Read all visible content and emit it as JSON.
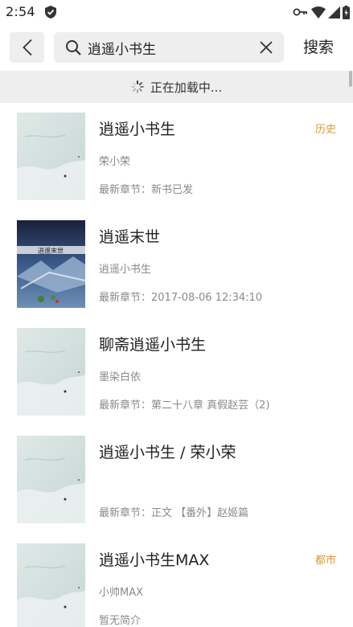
{
  "status_bar": {
    "time": "2:54",
    "icons": [
      "shield-icon",
      "key-icon",
      "wifi-icon",
      "signal-icon",
      "battery-icon"
    ]
  },
  "toolbar": {
    "back_icon": "chevron-left-icon",
    "search_query": "逍遥小书生",
    "search_button_label": "搜索"
  },
  "loading": {
    "text": "正在加载中..."
  },
  "colors": {
    "tag": "#d8963a",
    "secondary_text": "#8a8a8a",
    "panel_gray": "#eeeeee"
  },
  "results": [
    {
      "title": "逍遥小书生",
      "tag": "历史",
      "author": "荣小荣",
      "latest": "最新章节：新书已发",
      "cover": "default"
    },
    {
      "title": "逍遥末世",
      "tag": "",
      "author": "逍遥小书生",
      "latest": "最新章节：2017-08-06 12:34:10",
      "cover": "image",
      "cover_text": "逍遥末世"
    },
    {
      "title": "聊斋逍遥小书生",
      "tag": "",
      "author": "墨染白依",
      "latest": "最新章节：第二十八章 真假赵芸（2)",
      "cover": "default"
    },
    {
      "title": "逍遥小书生 / 荣小荣",
      "tag": "",
      "author": "",
      "latest": "最新章节：正文 【番外】赵姬篇",
      "cover": "default"
    },
    {
      "title": "逍遥小书生MAX",
      "tag": "都市",
      "author": "小帅MAX",
      "latest": "暂无简介",
      "cover": "default"
    }
  ]
}
